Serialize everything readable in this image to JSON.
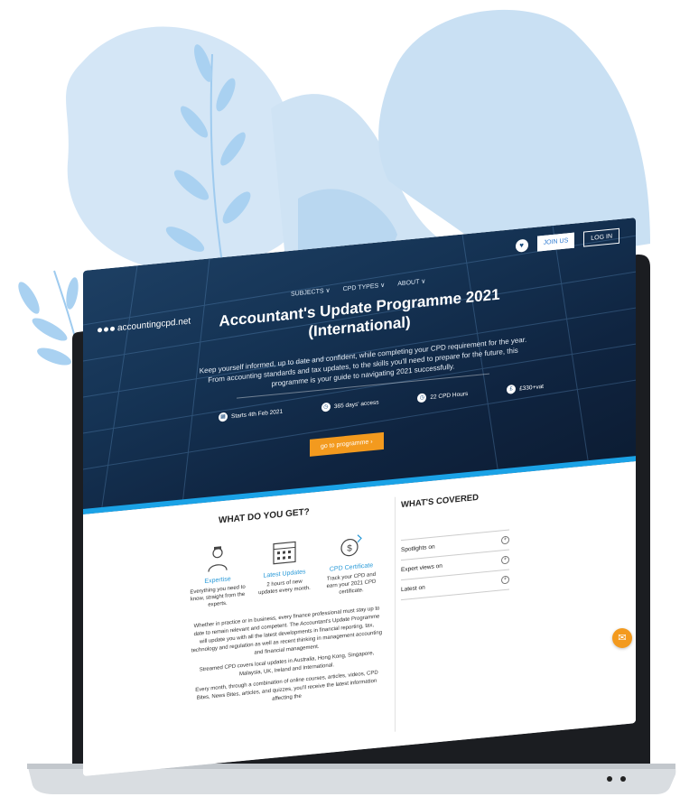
{
  "nav": {
    "logo_text": "accountingcpd.net",
    "menu": [
      "SUBJECTS ∨",
      "CPD TYPES ∨",
      "ABOUT ∨"
    ],
    "join_label": "JOIN US",
    "login_label": "LOG IN"
  },
  "hero": {
    "title_line1": "Accountant's Update Programme 2021",
    "title_line2": "(International)",
    "description": "Keep yourself informed, up to date and confident, while completing your CPD requirement for the year. From accounting standards and tax updates, to the skills you'll need to prepare for the future, this programme is your guide to navigating 2021 successfully.",
    "facts": [
      {
        "icon": "calendar-icon",
        "label": "Starts 4th Feb 2021"
      },
      {
        "icon": "clock-icon",
        "label": "365 days' access"
      },
      {
        "icon": "timer-icon",
        "label": "22 CPD Hours"
      },
      {
        "icon": "pound-icon",
        "label": "£330+vat"
      }
    ],
    "cta_label": "go to programme ›"
  },
  "content": {
    "heading": "WHAT DO YOU GET?",
    "features": [
      {
        "icon": "expert-icon",
        "title": "Expertise",
        "desc": "Everything you need to know, straight from the experts."
      },
      {
        "icon": "calendar-grid-icon",
        "title": "Latest Updates",
        "desc": "2 hours of new updates every month."
      },
      {
        "icon": "certificate-icon",
        "title": "CPD Certificate",
        "desc": "Track your CPD and earn your 2021 CPD certificate."
      }
    ],
    "paragraphs": [
      "Whether in practice or in business, every finance professional must stay up to date to remain relevant and competent. The Accountant's Update Programme will update you with all the latest developments in financial reporting, tax, technology and regulation as well as recent thinking in management accounting and financial management.",
      "Streamed CPD covers local updates in Australia, Hong Kong, Singapore, Malaysia, UK, Ireland and International.",
      "Every month, through a combination of online courses, articles, videos, CPD Bites, News Bites, articles, and quizzes, you'll receive the latest information affecting the"
    ]
  },
  "covered": {
    "heading": "WHAT'S COVERED",
    "items": [
      "Spotlights on",
      "Expert views on",
      "Latest on"
    ]
  },
  "colors": {
    "accent": "#2a9ad8",
    "cta": "#f39a1e",
    "blob": "#cfe3f4",
    "leaf": "#9fcbef"
  }
}
